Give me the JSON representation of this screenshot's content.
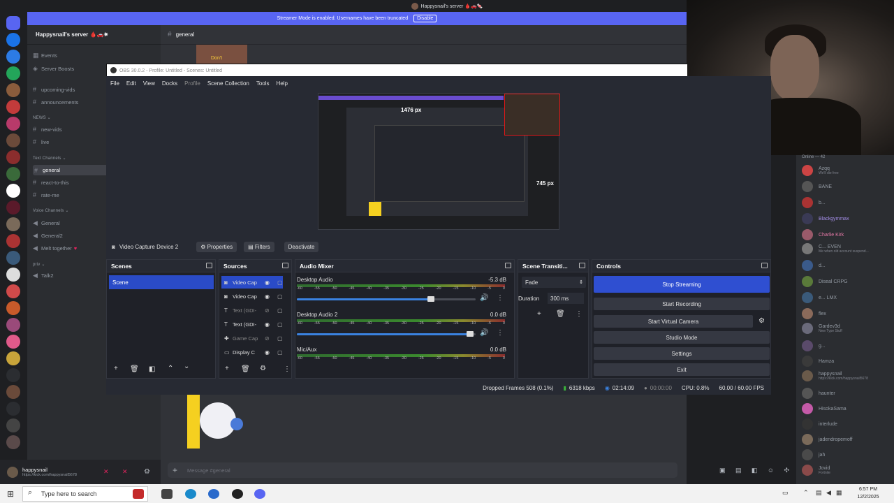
{
  "discord": {
    "window_title": "Happysnail's server 🩸🚗🍬",
    "streamer_banner": "Streamer Mode is enabled. Usernames have been truncated",
    "streamer_disable": "Disable",
    "server_name": "Happysnail's server 🩸🚗✷",
    "channel_header": "general",
    "channels_top": [
      "Events",
      "Server Boosts"
    ],
    "channels_a": [
      "upcoming-vids",
      "announcements"
    ],
    "category_news": "NEWS ⌄",
    "channels_news": [
      "new-vids",
      "live"
    ],
    "category_text": "Text Channels ⌄",
    "channels_text": [
      "general",
      "react-to-this",
      "rate-me"
    ],
    "category_voice": "Voice Channels ⌄",
    "channels_voice": [
      "General",
      "General2",
      "Melt together"
    ],
    "category_priv": "priv ⌄",
    "channels_priv": [
      "Talk2"
    ],
    "user_name": "happysnail",
    "user_status": "https://kick.com/happysnail5678",
    "message_placeholder": "Message #general",
    "members_header": "Online — 42",
    "members": [
      {
        "name": "Azqq",
        "sub": "We'll die free"
      },
      {
        "name": "BANE",
        "sub": ""
      },
      {
        "name": "b...",
        "sub": ""
      },
      {
        "name": "Blackgymmax",
        "sub": ""
      },
      {
        "name": "Charlie Kirk",
        "sub": ""
      },
      {
        "name": "C... EVEN",
        "sub": "Me when old account suspend..."
      },
      {
        "name": "d...",
        "sub": ""
      },
      {
        "name": "Diseal CRPG",
        "sub": ""
      },
      {
        "name": "e... LMX",
        "sub": ""
      },
      {
        "name": "flex",
        "sub": ""
      },
      {
        "name": "Gardev3d",
        "sub": "New Type Stuff"
      },
      {
        "name": "g...",
        "sub": ""
      },
      {
        "name": "Hamza",
        "sub": ""
      },
      {
        "name": "happysnail",
        "sub": "https://kick.com/happysnail5678"
      },
      {
        "name": "haunter",
        "sub": ""
      },
      {
        "name": "HisokaSama",
        "sub": ""
      },
      {
        "name": "interlude",
        "sub": ""
      },
      {
        "name": "jadendropemoff",
        "sub": ""
      },
      {
        "name": "jah",
        "sub": ""
      },
      {
        "name": "Jovid",
        "sub": "Fortnite"
      }
    ],
    "preview_labels": [
      "Don't"
    ]
  },
  "obs": {
    "title": "OBS 30.0.2 - Profile: Untitled - Scenes: Untitled",
    "menu": [
      "File",
      "Edit",
      "View",
      "Docks",
      "Profile",
      "Scene Collection",
      "Tools",
      "Help"
    ],
    "preview_px_w": "1476 px",
    "preview_px_h": "745 px",
    "selected_source": "Video Capture Device 2",
    "properties": "Properties",
    "filters": "Filters",
    "deactivate": "Deactivate",
    "docks": {
      "scenes": "Scenes",
      "sources": "Sources",
      "mixer": "Audio Mixer",
      "transitions": "Scene Transiti...",
      "controls": "Controls"
    },
    "scenes": [
      "Scene"
    ],
    "sources": [
      {
        "name": "Video Cap",
        "icon": "camera-icon"
      },
      {
        "name": "Video Cap",
        "icon": "camera-icon"
      },
      {
        "name": "Text (GDI-",
        "icon": "text-icon"
      },
      {
        "name": "Text (GDI-",
        "icon": "text-icon"
      },
      {
        "name": "Game Cap",
        "icon": "gamepad-icon"
      },
      {
        "name": "Display C",
        "icon": "monitor-icon"
      }
    ],
    "mixer": [
      {
        "name": "Desktop Audio",
        "db": "-5.3 dB",
        "volume": 0.75
      },
      {
        "name": "Desktop Audio 2",
        "db": "0.0 dB",
        "volume": 0.97
      },
      {
        "name": "Mic/Aux",
        "db": "0.0 dB",
        "volume": 1.0
      }
    ],
    "meter_ticks": [
      "-60",
      "-55",
      "-50",
      "-45",
      "-40",
      "-35",
      "-30",
      "-25",
      "-20",
      "-15",
      "-10",
      "-5",
      "0"
    ],
    "transition": "Fade",
    "duration_label": "Duration",
    "duration_value": "300 ms",
    "controls": [
      "Stop Streaming",
      "Start Recording",
      "Start Virtual Camera",
      "Studio Mode",
      "Settings",
      "Exit"
    ],
    "status": {
      "dropped": "Dropped Frames 508 (0.1%)",
      "kbps": "6318 kbps",
      "stream_time": "02:14:09",
      "rec_time": "00:00:00",
      "cpu": "CPU: 0.8%",
      "fps": "60.00 / 60.00 FPS"
    }
  },
  "taskbar": {
    "search_placeholder": "Type here to search",
    "time": "6:57 PM",
    "date": "12/2/2025"
  },
  "colors": {
    "discord_accent": "#5865f2",
    "obs_selected": "#2a4bc7",
    "stop_stream": "#2f4fd1"
  }
}
